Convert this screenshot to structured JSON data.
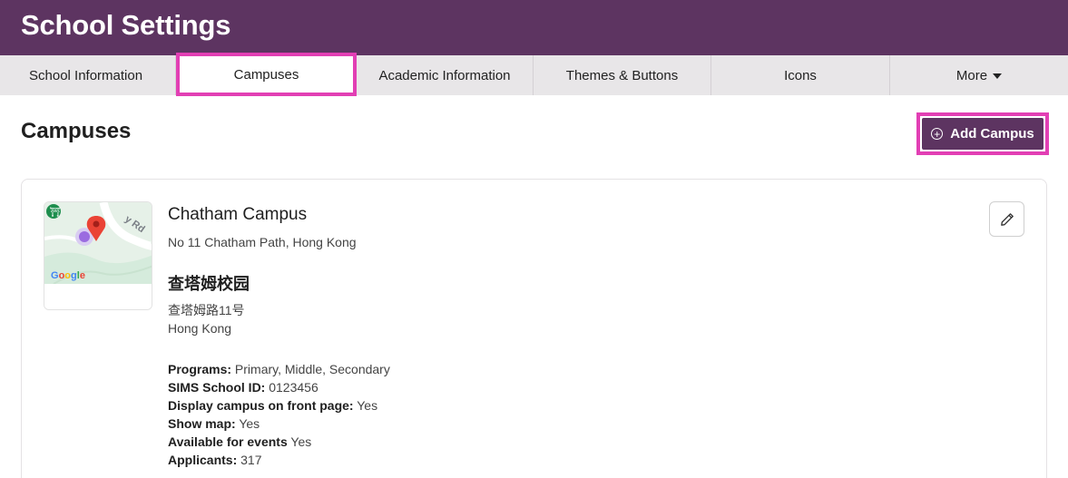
{
  "header": {
    "title": "School Settings"
  },
  "tabs": [
    {
      "label": "School Information",
      "active": false
    },
    {
      "label": "Campuses",
      "active": true
    },
    {
      "label": "Academic Information",
      "active": false
    },
    {
      "label": "Themes & Buttons",
      "active": false
    },
    {
      "label": "Icons",
      "active": false
    },
    {
      "label": "More",
      "active": false
    }
  ],
  "main": {
    "title": "Campuses",
    "add_button_label": "Add Campus",
    "campus": {
      "name": "Chatham Campus",
      "address": "No 11 Chatham Path, Hong Kong",
      "cn_name": "查塔姆校园",
      "cn_address_line1": "查塔姆路11号",
      "cn_address_line2": "Hong Kong",
      "map": {
        "provider_label": "Google",
        "road_label": "y Rd"
      },
      "details": [
        {
          "label": "Programs:",
          "value": "Primary, Middle, Secondary"
        },
        {
          "label": "SIMS School ID:",
          "value": "0123456"
        },
        {
          "label": "Display campus on front page:",
          "value": "Yes"
        },
        {
          "label": "Show map:",
          "value": "Yes"
        },
        {
          "label": "Available for events",
          "value": "Yes"
        },
        {
          "label": "Applicants:",
          "value": "317"
        }
      ]
    }
  },
  "colors": {
    "brand": "#5d3461",
    "highlight": "#e23fb4",
    "tab_bg": "#e8e6e8"
  },
  "icons": {
    "add": "plus-circle-icon",
    "edit": "pencil-icon",
    "more": "caret-down-icon"
  }
}
